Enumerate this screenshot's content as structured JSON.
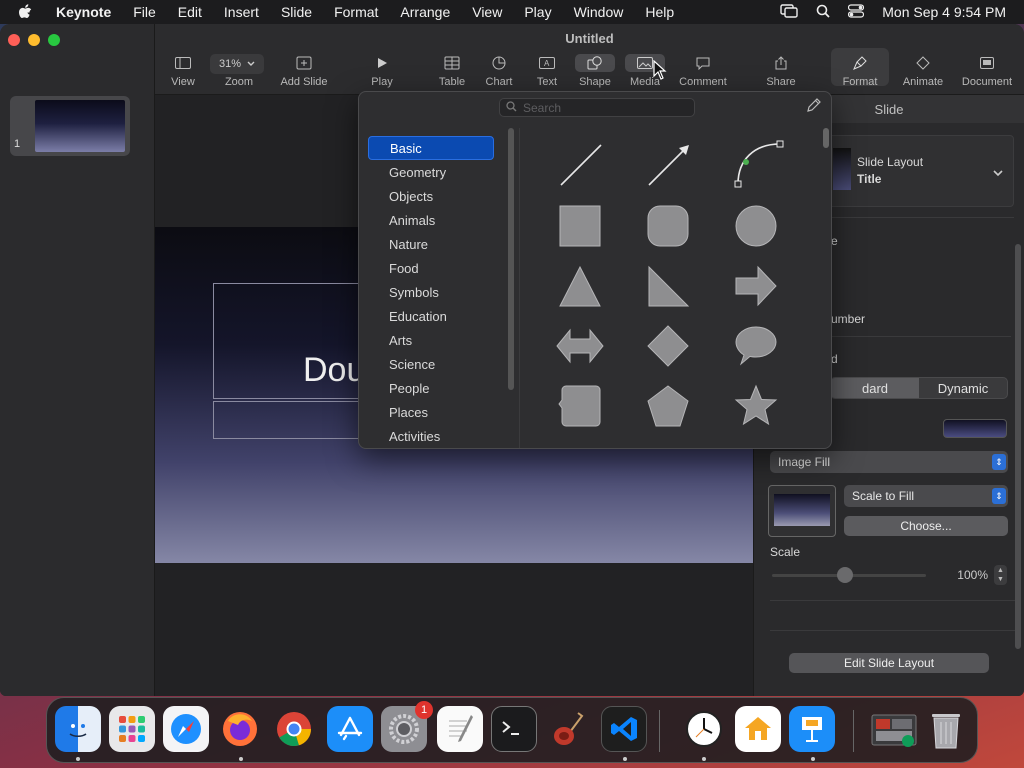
{
  "menubar": {
    "app_name": "Keynote",
    "items": [
      "File",
      "Edit",
      "Insert",
      "Slide",
      "Format",
      "Arrange",
      "View",
      "Play",
      "Window",
      "Help"
    ],
    "clock": "Mon Sep 4  9:54 PM"
  },
  "window": {
    "title": "Untitled"
  },
  "sidebar": {
    "slide_number": "1"
  },
  "toolbar": {
    "zoom_value": "31%",
    "view": "View",
    "zoom": "Zoom",
    "add_slide": "Add Slide",
    "play": "Play",
    "table": "Table",
    "chart": "Chart",
    "text": "Text",
    "shape": "Shape",
    "media": "Media",
    "comment": "Comment",
    "share": "Share",
    "format": "Format",
    "animate": "Animate",
    "document": "Document"
  },
  "slide": {
    "title_visible_text": "Dou"
  },
  "popover": {
    "search_placeholder": "Search",
    "categories": [
      "Basic",
      "Geometry",
      "Objects",
      "Animals",
      "Nature",
      "Food",
      "Symbols",
      "Education",
      "Arts",
      "Science",
      "People",
      "Places",
      "Activities"
    ],
    "selected_category": "Basic",
    "shapes": [
      "line",
      "arrow-line",
      "curve",
      "square",
      "rounded-square",
      "circle",
      "triangle",
      "right-triangle",
      "arrow",
      "double-arrow",
      "diamond",
      "speech-bubble",
      "callout-square",
      "pentagon",
      "star"
    ]
  },
  "inspector": {
    "tab_label": "Slide",
    "layout_label": "Slide Layout",
    "layout_value": "Title",
    "partial_e": "e",
    "partial_umber": "umber",
    "partial_d": "d",
    "seg_standard": "dard",
    "seg_dynamic": "Dynamic",
    "fill_type": "Image Fill",
    "scale_mode": "Scale to Fill",
    "choose_label": "Choose...",
    "scale_label": "Scale",
    "scale_value": "100%",
    "edit_layout_label": "Edit Slide Layout"
  },
  "dock": {
    "apps": [
      "Finder",
      "Launchpad",
      "Safari",
      "Firefox",
      "Chrome",
      "App Store",
      "System Settings",
      "TextEdit",
      "Terminal",
      "GarageBand",
      "Visual Studio Code",
      "Clock",
      "Home",
      "Keynote",
      "Preview",
      "Trash"
    ],
    "settings_badge": "1"
  },
  "colors": {
    "accent": "#0b4ab1",
    "wallpaper_a": "#2b3a5a",
    "wallpaper_b": "#c0483c"
  }
}
